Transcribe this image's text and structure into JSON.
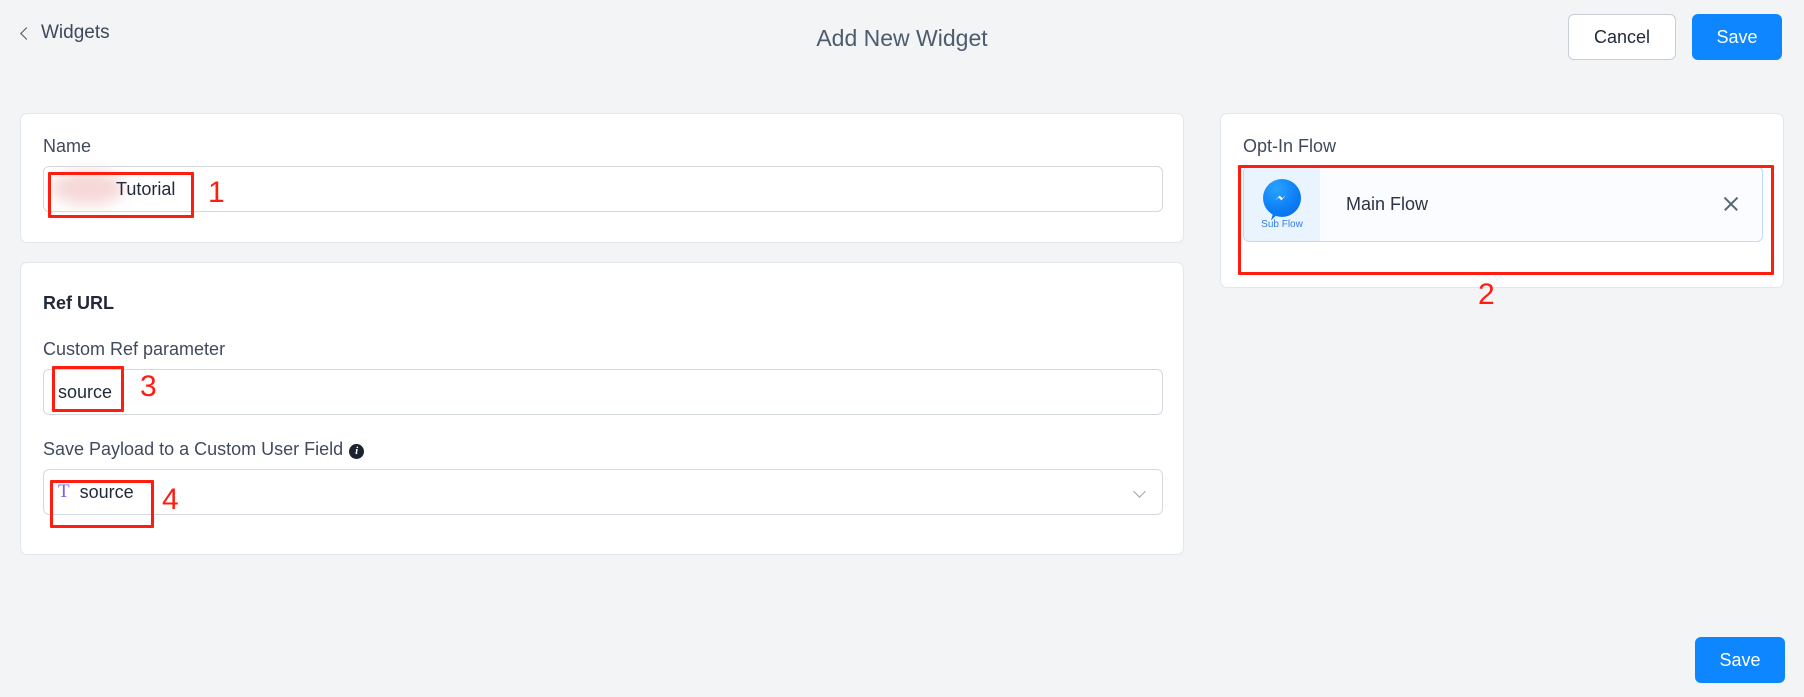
{
  "header": {
    "back_label": "Widgets",
    "back_icon": "chevron-left-icon",
    "title": "Add New Widget",
    "cancel_label": "Cancel",
    "save_label": "Save"
  },
  "name_card": {
    "label": "Name",
    "value": "Tutorial",
    "redacted": true
  },
  "ref_card": {
    "section_title": "Ref URL",
    "custom_ref": {
      "label": "Custom Ref parameter",
      "value": "source"
    },
    "payload_field": {
      "label": "Save Payload to a Custom User Field",
      "info_icon": "info-icon",
      "value": "source",
      "value_icon": "text-type-icon",
      "chevron": "chevron-down-icon"
    }
  },
  "flow_card": {
    "label": "Opt-In Flow",
    "item": {
      "thumb_icon": "messenger-icon",
      "thumb_label": "Sub Flow",
      "name": "Main Flow",
      "close_icon": "close-icon"
    }
  },
  "footer": {
    "save_label": "Save"
  },
  "annotations": {
    "one": "1",
    "two": "2",
    "three": "3",
    "four": "4"
  },
  "colors": {
    "primary": "#0d86ff",
    "annotation": "#ff1d10",
    "page_bg": "#f2f4f6",
    "card_bg": "#ffffff",
    "flow_accent": "#2f80ed",
    "type_icon": "#7b5cf0"
  }
}
